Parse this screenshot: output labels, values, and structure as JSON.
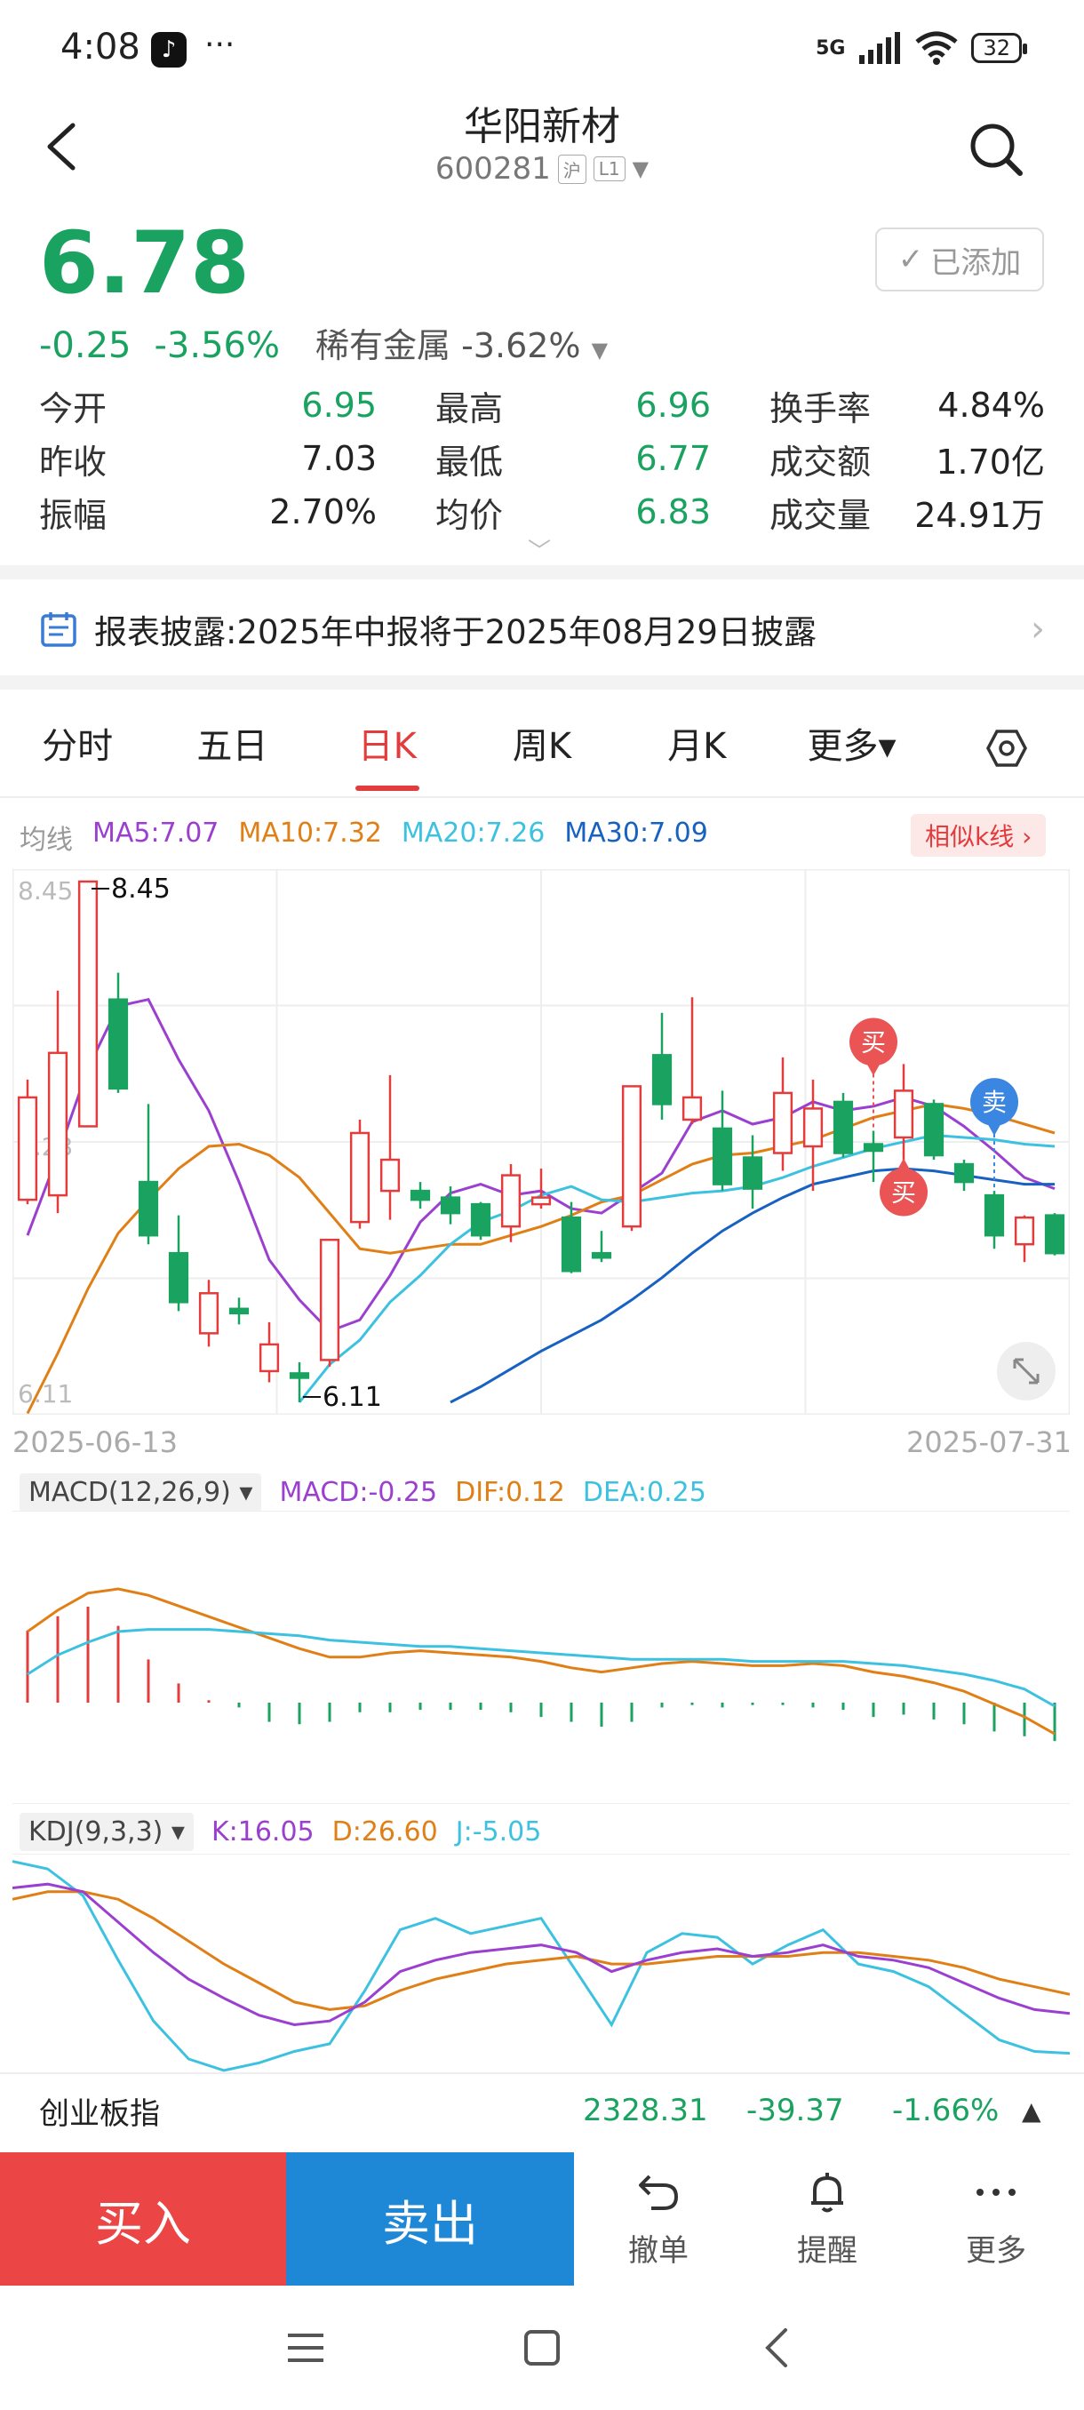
{
  "status_bar": {
    "time": "4:08",
    "app_icon": "tiktok-icon",
    "more": "···",
    "network": "5G",
    "battery": "32"
  },
  "header": {
    "name": "华阳新材",
    "code": "600281",
    "exchange_tag": "沪",
    "level_tag": "L1"
  },
  "quote": {
    "price": "6.78",
    "change": "-0.25",
    "change_pct": "-3.56%",
    "sector": "稀有金属 -3.62%",
    "added_label": "已添加",
    "stats": [
      [
        {
          "label": "今开",
          "value": "6.95",
          "color": "green"
        },
        {
          "label": "昨收",
          "value": "7.03",
          "color": "dark"
        },
        {
          "label": "振幅",
          "value": "2.70%",
          "color": "dark"
        }
      ],
      [
        {
          "label": "最高",
          "value": "6.96",
          "color": "green"
        },
        {
          "label": "最低",
          "value": "6.77",
          "color": "green"
        },
        {
          "label": "均价",
          "value": "6.83",
          "color": "green"
        }
      ],
      [
        {
          "label": "换手率",
          "value": "4.84%",
          "color": "dark"
        },
        {
          "label": "成交额",
          "value": "1.70亿",
          "color": "dark"
        },
        {
          "label": "成交量",
          "value": "24.91万",
          "color": "dark"
        }
      ]
    ]
  },
  "notice": {
    "text": "报表披露:2025年中报将于2025年08月29日披露"
  },
  "tabs": [
    {
      "label": "分时"
    },
    {
      "label": "五日"
    },
    {
      "label": "日K",
      "active": true
    },
    {
      "label": "周K"
    },
    {
      "label": "月K"
    },
    {
      "label": "更多▾"
    }
  ],
  "ma_legend": {
    "title": "均线",
    "ma5": "MA5:7.07",
    "ma10": "MA10:7.32",
    "ma20": "MA20:7.26",
    "ma30": "MA30:7.09",
    "similar": "相似k线 ›"
  },
  "colors": {
    "up": "#e23c3c",
    "down": "#1aa260",
    "ma5": "#9b3fd0",
    "ma10": "#e07f16",
    "ma20": "#3cc2e0",
    "ma30": "#1761c2"
  },
  "chart_data": {
    "type": "candlestick",
    "x_start": "2025-06-13",
    "x_end": "2025-07-31",
    "y_labels": [
      "8.45",
      "7.23",
      "6.11"
    ],
    "ylim": [
      6.11,
      8.45
    ],
    "high_label": "8.45",
    "low_label": "6.11",
    "candles": [
      {
        "o": 7.02,
        "c": 7.48,
        "h": 7.56,
        "l": 7.0
      },
      {
        "o": 7.04,
        "c": 7.68,
        "h": 7.96,
        "l": 6.96
      },
      {
        "o": 7.35,
        "c": 8.45,
        "h": 8.45,
        "l": 7.35
      },
      {
        "o": 7.92,
        "c": 7.52,
        "h": 8.04,
        "l": 7.5
      },
      {
        "o": 7.1,
        "c": 6.86,
        "h": 7.45,
        "l": 6.82
      },
      {
        "o": 6.78,
        "c": 6.56,
        "h": 6.95,
        "l": 6.52
      },
      {
        "o": 6.42,
        "c": 6.6,
        "h": 6.66,
        "l": 6.36
      },
      {
        "o": 6.53,
        "c": 6.51,
        "h": 6.58,
        "l": 6.46
      },
      {
        "o": 6.25,
        "c": 6.37,
        "h": 6.47,
        "l": 6.2
      },
      {
        "o": 6.24,
        "c": 6.22,
        "h": 6.29,
        "l": 6.11
      },
      {
        "o": 6.3,
        "c": 6.84,
        "h": 6.84,
        "l": 6.27
      },
      {
        "o": 6.92,
        "c": 7.32,
        "h": 7.38,
        "l": 6.89
      },
      {
        "o": 7.06,
        "c": 7.2,
        "h": 7.58,
        "l": 6.93
      },
      {
        "o": 7.06,
        "c": 7.02,
        "h": 7.1,
        "l": 6.98
      },
      {
        "o": 7.03,
        "c": 6.96,
        "h": 7.08,
        "l": 6.91
      },
      {
        "o": 7.0,
        "c": 6.86,
        "h": 7.01,
        "l": 6.84
      },
      {
        "o": 6.9,
        "c": 7.13,
        "h": 7.18,
        "l": 6.83
      },
      {
        "o": 7.0,
        "c": 7.03,
        "h": 7.16,
        "l": 6.98
      },
      {
        "o": 6.94,
        "c": 6.7,
        "h": 7.01,
        "l": 6.69
      },
      {
        "o": 6.78,
        "c": 6.76,
        "h": 6.88,
        "l": 6.74
      },
      {
        "o": 6.9,
        "c": 7.53,
        "h": 7.53,
        "l": 6.88
      },
      {
        "o": 7.67,
        "c": 7.45,
        "h": 7.86,
        "l": 7.38
      },
      {
        "o": 7.38,
        "c": 7.48,
        "h": 7.93,
        "l": 7.36
      },
      {
        "o": 7.34,
        "c": 7.09,
        "h": 7.51,
        "l": 7.06
      },
      {
        "o": 7.21,
        "c": 7.07,
        "h": 7.31,
        "l": 6.98
      },
      {
        "o": 7.23,
        "c": 7.5,
        "h": 7.66,
        "l": 7.15
      },
      {
        "o": 7.26,
        "c": 7.43,
        "h": 7.56,
        "l": 7.06
      },
      {
        "o": 7.46,
        "c": 7.23,
        "h": 7.5,
        "l": 7.21
      },
      {
        "o": 7.27,
        "c": 7.24,
        "h": 7.33,
        "l": 7.1
      },
      {
        "o": 7.3,
        "c": 7.51,
        "h": 7.63,
        "l": 7.19
      },
      {
        "o": 7.45,
        "c": 7.22,
        "h": 7.47,
        "l": 7.2
      },
      {
        "o": 7.18,
        "c": 7.1,
        "h": 7.2,
        "l": 7.06
      },
      {
        "o": 7.04,
        "c": 6.86,
        "h": 7.06,
        "l": 6.8
      },
      {
        "o": 6.82,
        "c": 6.94,
        "h": 6.95,
        "l": 6.74
      },
      {
        "o": 6.95,
        "c": 6.78,
        "h": 6.96,
        "l": 6.77
      }
    ],
    "ma5": [
      6.86,
      7.22,
      7.61,
      7.89,
      7.92,
      7.65,
      7.42,
      7.1,
      6.75,
      6.57,
      6.43,
      6.48,
      6.68,
      6.92,
      7.05,
      7.09,
      7.04,
      7.06,
      6.98,
      6.96,
      7.05,
      7.14,
      7.37,
      7.42,
      7.36,
      7.39,
      7.46,
      7.42,
      7.44,
      7.48,
      7.44,
      7.35,
      7.24,
      7.12,
      7.07
    ],
    "ma10": [
      6.06,
      6.33,
      6.62,
      6.87,
      7.02,
      7.16,
      7.26,
      7.27,
      7.22,
      7.12,
      6.96,
      6.8,
      6.78,
      6.8,
      6.82,
      6.82,
      6.86,
      6.9,
      6.95,
      7.01,
      7.04,
      7.11,
      7.18,
      7.22,
      7.23,
      7.26,
      7.29,
      7.34,
      7.39,
      7.42,
      7.45,
      7.43,
      7.4,
      7.36,
      7.32
    ],
    "ma20": [
      null,
      null,
      null,
      null,
      null,
      null,
      null,
      null,
      null,
      6.11,
      6.28,
      6.39,
      6.56,
      6.68,
      6.82,
      6.92,
      6.97,
      7.04,
      7.08,
      7.02,
      7.01,
      7.03,
      7.05,
      7.06,
      7.08,
      7.12,
      7.17,
      7.21,
      7.25,
      7.28,
      7.31,
      7.3,
      7.29,
      7.27,
      7.26
    ],
    "ma30": [
      null,
      null,
      null,
      null,
      null,
      null,
      null,
      null,
      null,
      null,
      null,
      null,
      null,
      null,
      6.11,
      6.18,
      6.26,
      6.34,
      6.41,
      6.48,
      6.57,
      6.67,
      6.78,
      6.88,
      6.96,
      7.03,
      7.09,
      7.12,
      7.15,
      7.16,
      7.15,
      7.13,
      7.11,
      7.09,
      7.09
    ],
    "markers": [
      {
        "index": 28,
        "label": "买",
        "position": "top"
      },
      {
        "index": 29,
        "label": "买",
        "position": "bottom"
      },
      {
        "index": 32,
        "label": "卖",
        "position": "top"
      }
    ]
  },
  "macd": {
    "selector": "MACD(12,26,9) ▾",
    "macd": "MACD:-0.25",
    "dif": "DIF:0.12",
    "dea": "DEA:0.25",
    "bars": [
      0.3,
      0.36,
      0.4,
      0.32,
      0.18,
      0.08,
      0.01,
      -0.02,
      -0.08,
      -0.09,
      -0.08,
      -0.04,
      -0.04,
      -0.03,
      -0.03,
      -0.03,
      -0.04,
      -0.06,
      -0.08,
      -0.1,
      -0.08,
      -0.02,
      -0.01,
      -0.02,
      -0.01,
      -0.01,
      -0.02,
      -0.03,
      -0.06,
      -0.05,
      -0.07,
      -0.09,
      -0.12,
      -0.14,
      -0.16
    ],
    "dif_line": [
      0.6,
      0.7,
      0.78,
      0.8,
      0.77,
      0.72,
      0.67,
      0.62,
      0.57,
      0.52,
      0.48,
      0.48,
      0.5,
      0.51,
      0.5,
      0.49,
      0.48,
      0.46,
      0.43,
      0.41,
      0.43,
      0.45,
      0.46,
      0.45,
      0.44,
      0.44,
      0.45,
      0.44,
      0.41,
      0.39,
      0.36,
      0.32,
      0.26,
      0.2,
      0.12
    ],
    "dea_line": [
      0.4,
      0.49,
      0.55,
      0.6,
      0.61,
      0.61,
      0.61,
      0.6,
      0.59,
      0.58,
      0.56,
      0.55,
      0.54,
      0.53,
      0.53,
      0.52,
      0.51,
      0.5,
      0.49,
      0.48,
      0.47,
      0.47,
      0.47,
      0.47,
      0.46,
      0.46,
      0.46,
      0.46,
      0.45,
      0.44,
      0.42,
      0.4,
      0.37,
      0.33,
      0.25
    ]
  },
  "kdj": {
    "selector": "KDJ(9,3,3) ▾",
    "k": "K:16.05",
    "d": "D:26.60",
    "j": "J:-5.05",
    "k_line": [
      82,
      84,
      80,
      64,
      48,
      34,
      24,
      15,
      10,
      12,
      22,
      38,
      44,
      48,
      50,
      52,
      48,
      38,
      44,
      48,
      50,
      46,
      48,
      52,
      46,
      44,
      40,
      32,
      24,
      18,
      16
    ],
    "d_line": [
      76,
      80,
      80,
      76,
      66,
      54,
      42,
      32,
      22,
      18,
      20,
      28,
      34,
      38,
      42,
      44,
      46,
      42,
      42,
      44,
      46,
      46,
      46,
      48,
      48,
      46,
      44,
      40,
      34,
      30,
      26
    ],
    "j_line": [
      96,
      92,
      78,
      44,
      12,
      -8,
      -14,
      -10,
      -4,
      0,
      28,
      60,
      66,
      58,
      62,
      66,
      38,
      10,
      48,
      58,
      56,
      42,
      52,
      60,
      42,
      38,
      30,
      16,
      2,
      -4,
      -5
    ]
  },
  "index_bar": {
    "name": "创业板指",
    "value": "2328.31",
    "change": "-39.37",
    "pct": "-1.66%"
  },
  "actions": {
    "buy": "买入",
    "sell": "卖出",
    "cancel": "撤单",
    "alert": "提醒",
    "more": "更多"
  }
}
